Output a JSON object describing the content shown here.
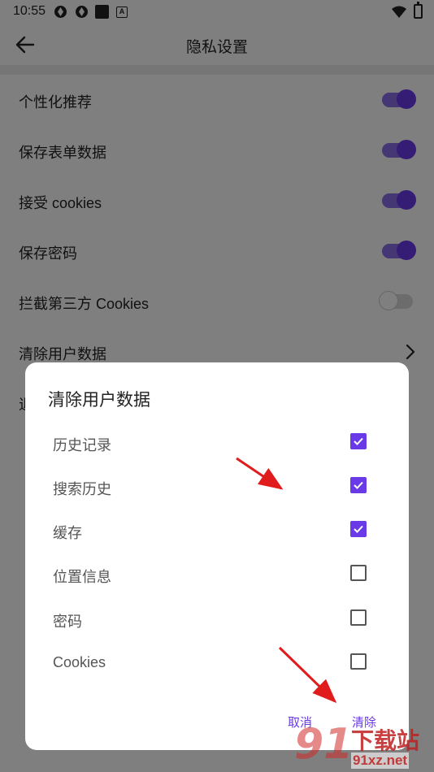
{
  "status_bar": {
    "time": "10:55",
    "icons": [
      "sync-icon",
      "sync-icon",
      "square-notification-icon",
      "a-notification-icon",
      "wifi-icon",
      "battery-charging-icon"
    ],
    "a_icon_glyph": "A"
  },
  "app_bar": {
    "title": "隐私设置",
    "back_icon": "back-arrow-icon"
  },
  "settings": [
    {
      "label": "个性化推荐",
      "control": "switch",
      "state": "on"
    },
    {
      "label": "保存表单数据",
      "control": "switch",
      "state": "on"
    },
    {
      "label": "接受 cookies",
      "control": "switch",
      "state": "on"
    },
    {
      "label": "保存密码",
      "control": "switch",
      "state": "on"
    },
    {
      "label": "拦截第三方 Cookies",
      "control": "switch",
      "state": "off"
    },
    {
      "label": "清除用户数据",
      "control": "chevron-right-icon"
    },
    {
      "label": "退"
    }
  ],
  "dialog": {
    "title": "清除用户数据",
    "options": [
      {
        "label": "历史记录",
        "checked": true
      },
      {
        "label": "搜索历史",
        "checked": true
      },
      {
        "label": "缓存",
        "checked": true
      },
      {
        "label": "位置信息",
        "checked": false
      },
      {
        "label": "密码",
        "checked": false
      },
      {
        "label": "Cookies",
        "checked": false
      }
    ],
    "cancel_label": "取消",
    "confirm_label": "清除"
  },
  "watermark": {
    "logo_text": "91",
    "brand": "下载站",
    "url": "91xz.net"
  },
  "colors": {
    "accent": "#6a39e8",
    "switch_track_on": "#8a6ee8",
    "annotation_arrow": "#e01c1c",
    "scrim": "rgba(0,0,0,0.5)"
  }
}
